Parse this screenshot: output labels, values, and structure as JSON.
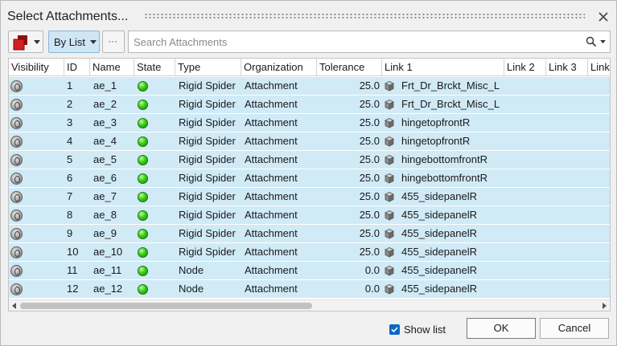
{
  "window": {
    "title": "Select Attachments..."
  },
  "toolbar": {
    "list_mode_label": "By List",
    "more_label": "···",
    "color_swatch": "#d21f1f"
  },
  "search": {
    "placeholder": "Search Attachments",
    "value": ""
  },
  "columns": [
    "Visibility",
    "ID",
    "Name",
    "State",
    "Type",
    "Organization",
    "Tolerance",
    "Link 1",
    "Link 2",
    "Link 3",
    "Link"
  ],
  "rows": [
    {
      "id": "1",
      "name": "ae_1",
      "type": "Rigid Spider",
      "organization": "Attachment",
      "tolerance": "25.0",
      "link1": "Frt_Dr_Brckt_Misc_L"
    },
    {
      "id": "2",
      "name": "ae_2",
      "type": "Rigid Spider",
      "organization": "Attachment",
      "tolerance": "25.0",
      "link1": "Frt_Dr_Brckt_Misc_L"
    },
    {
      "id": "3",
      "name": "ae_3",
      "type": "Rigid Spider",
      "organization": "Attachment",
      "tolerance": "25.0",
      "link1": "hingetopfrontR"
    },
    {
      "id": "4",
      "name": "ae_4",
      "type": "Rigid Spider",
      "organization": "Attachment",
      "tolerance": "25.0",
      "link1": "hingetopfrontR"
    },
    {
      "id": "5",
      "name": "ae_5",
      "type": "Rigid Spider",
      "organization": "Attachment",
      "tolerance": "25.0",
      "link1": "hingebottomfrontR"
    },
    {
      "id": "6",
      "name": "ae_6",
      "type": "Rigid Spider",
      "organization": "Attachment",
      "tolerance": "25.0",
      "link1": "hingebottomfrontR"
    },
    {
      "id": "7",
      "name": "ae_7",
      "type": "Rigid Spider",
      "organization": "Attachment",
      "tolerance": "25.0",
      "link1": "455_sidepanelR"
    },
    {
      "id": "8",
      "name": "ae_8",
      "type": "Rigid Spider",
      "organization": "Attachment",
      "tolerance": "25.0",
      "link1": "455_sidepanelR"
    },
    {
      "id": "9",
      "name": "ae_9",
      "type": "Rigid Spider",
      "organization": "Attachment",
      "tolerance": "25.0",
      "link1": "455_sidepanelR"
    },
    {
      "id": "10",
      "name": "ae_10",
      "type": "Rigid Spider",
      "organization": "Attachment",
      "tolerance": "25.0",
      "link1": "455_sidepanelR"
    },
    {
      "id": "11",
      "name": "ae_11",
      "type": "Node",
      "organization": "Attachment",
      "tolerance": "0.0",
      "link1": "455_sidepanelR"
    },
    {
      "id": "12",
      "name": "ae_12",
      "type": "Node",
      "organization": "Attachment",
      "tolerance": "0.0",
      "link1": "455_sidepanelR"
    }
  ],
  "footer": {
    "show_list_label": "Show list",
    "show_list_checked": true,
    "ok_label": "OK",
    "cancel_label": "Cancel"
  },
  "colors": {
    "row_bg": "#d0eaf6",
    "state_ok": "#3ccb1e",
    "checkbox": "#0b67c7"
  }
}
